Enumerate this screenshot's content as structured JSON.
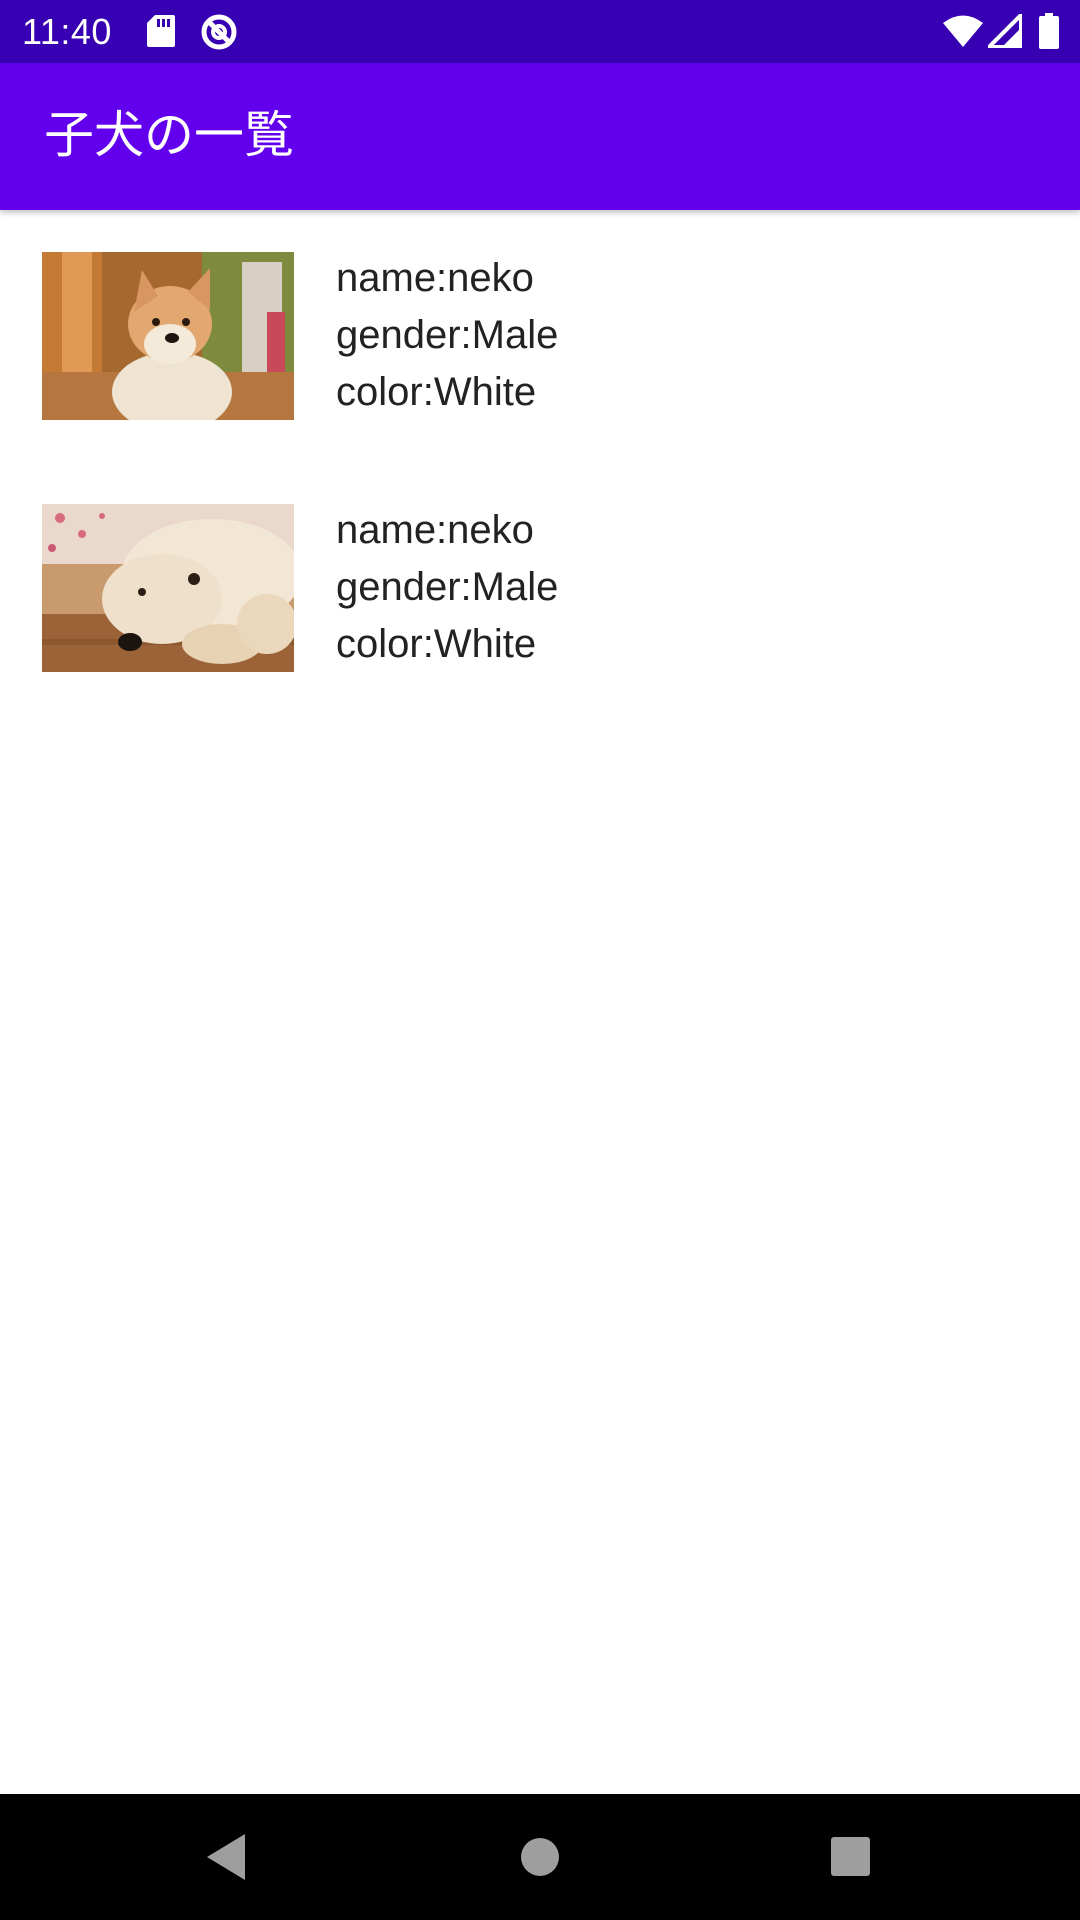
{
  "status_bar": {
    "time": "11:40",
    "icons": [
      "sd-card-icon",
      "data-saver-icon",
      "wifi-icon",
      "signal-icon",
      "battery-icon"
    ],
    "background": "#3700b3"
  },
  "app_bar": {
    "title": "子犬の一覧",
    "background": "#6200ee"
  },
  "puppies": [
    {
      "image": "shiba-puppy-photo",
      "name": "name:neko",
      "gender": "gender:Male",
      "color": "color:White"
    },
    {
      "image": "poodle-puppy-photo",
      "name": "name:neko",
      "gender": "gender:Male",
      "color": "color:White"
    }
  ],
  "nav_bar": {
    "icons": [
      "back-icon",
      "home-icon",
      "recents-icon"
    ]
  }
}
